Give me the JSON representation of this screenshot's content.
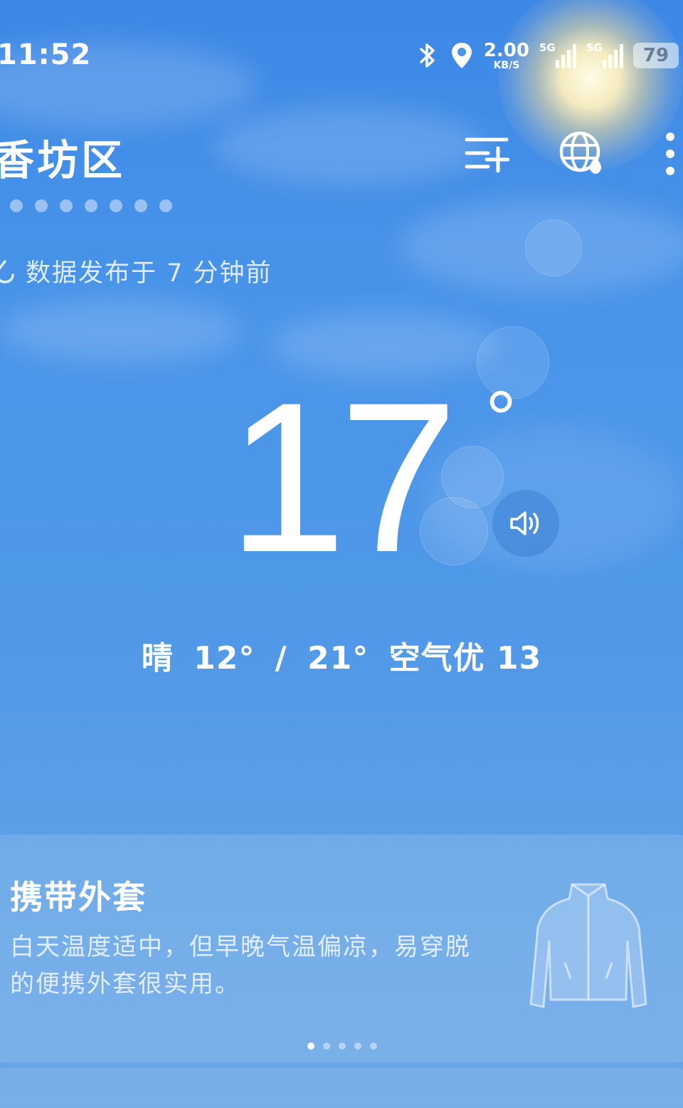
{
  "status_bar": {
    "time": "11:52",
    "net_speed_value": "2.00",
    "net_speed_unit": "KB/S",
    "sim1_tag": "5G",
    "sim2_tag": "5G",
    "battery": "79",
    "icons": [
      "bluetooth-icon",
      "location-icon"
    ]
  },
  "header": {
    "city": "香坊区",
    "page_count": 7,
    "buttons": [
      "add-city-icon",
      "globe-icon",
      "more-icon"
    ]
  },
  "publish": {
    "text": "数据发布于 7 分钟前"
  },
  "current": {
    "temperature": "17",
    "degree": "°",
    "condition": "晴",
    "low": "12°",
    "separator": "/",
    "high": "21°",
    "air_quality": "空气优 13"
  },
  "tip_card": {
    "title": "携带外套",
    "body": "白天温度适中，但早晚气温偏凉，易穿脱的便携外套很实用。",
    "dot_count": 5,
    "active_dot": 0,
    "icon": "jacket-icon"
  },
  "colors": {
    "sky_top": "#3d88e6",
    "sky_bottom": "#6aa6e6",
    "text": "#ffffff"
  }
}
